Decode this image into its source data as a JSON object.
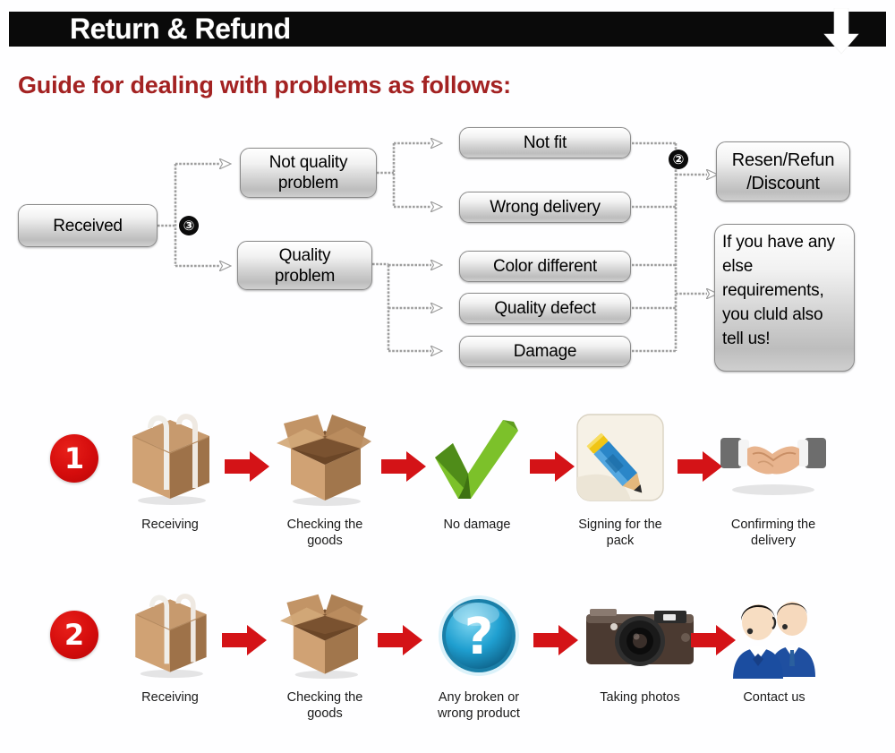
{
  "header": {
    "title": "Return & Refund",
    "arrow_icon": "down-arrow-icon"
  },
  "guide": {
    "heading": "Guide for dealing with problems as follows:"
  },
  "flowchart": {
    "nodes": {
      "received": "Received",
      "not_quality_problem": "Not quality\nproblem",
      "quality_problem": "Quality\nproblem",
      "not_fit": "Not fit",
      "wrong_delivery": "Wrong delivery",
      "color_different": "Color different",
      "quality_defect": "Quality defect",
      "damage": "Damage",
      "resolution": "Resen/Refun\n/Discount",
      "extra_requirements": "If you have any else requirements, you cluld also tell us!"
    },
    "badges": {
      "branch": "③",
      "resolution": "②"
    }
  },
  "process_rows": [
    {
      "number": "1",
      "steps": [
        {
          "icon": "sealed-box-icon",
          "caption": "Receiving"
        },
        {
          "icon": "open-box-icon",
          "caption": "Checking the goods"
        },
        {
          "icon": "green-check-icon",
          "caption": "No damage"
        },
        {
          "icon": "pencil-signing-icon",
          "caption": "Signing for the pack"
        },
        {
          "icon": "handshake-icon",
          "caption": "Confirming the delivery"
        }
      ]
    },
    {
      "number": "2",
      "steps": [
        {
          "icon": "sealed-box-icon",
          "caption": "Receiving"
        },
        {
          "icon": "open-box-icon",
          "caption": "Checking the goods"
        },
        {
          "icon": "question-mark-icon",
          "caption": "Any broken or wrong product"
        },
        {
          "icon": "camera-icon",
          "caption": "Taking photos"
        },
        {
          "icon": "support-agents-icon",
          "caption": "Contact us"
        }
      ]
    }
  ],
  "colors": {
    "header_bg": "#0a0a0a",
    "header_text": "#ffffff",
    "guide_text": "#a32222",
    "arrow_red": "#d10a0a",
    "step_circle": "#d40c0c",
    "node_border": "#8b8b8b",
    "page_bg": "#fefeff"
  }
}
